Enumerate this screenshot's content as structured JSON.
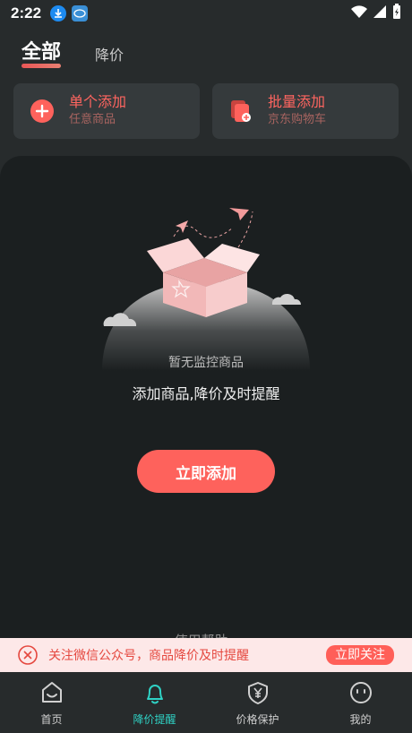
{
  "status_bar": {
    "time": "2:22"
  },
  "tabs": [
    {
      "label": "全部",
      "active": true
    },
    {
      "label": "降价",
      "active": false
    }
  ],
  "cards": [
    {
      "title": "单个添加",
      "subtitle": "任意商品",
      "icon": "plus-circle-icon"
    },
    {
      "title": "批量添加",
      "subtitle": "京东购物车",
      "icon": "cart-add-icon"
    }
  ],
  "empty_state": {
    "title": "暂无监控商品",
    "description": "添加商品,降价及时提醒",
    "add_button": "立即添加",
    "help_link": "使用帮助 ›"
  },
  "banner": {
    "text": "关注微信公众号，商品降价及时提醒",
    "button": "立即关注"
  },
  "bottom_nav": [
    {
      "label": "首页",
      "icon": "home-icon",
      "active": false
    },
    {
      "label": "降价提醒",
      "icon": "bell-icon",
      "active": true
    },
    {
      "label": "价格保护",
      "icon": "shield-yen-icon",
      "active": false
    },
    {
      "label": "我的",
      "icon": "profile-face-icon",
      "active": false
    }
  ],
  "colors": {
    "accent": "#fe625c",
    "active_nav": "#2fd2c5",
    "background": "#272b2c",
    "panel": "#1b1f20"
  }
}
